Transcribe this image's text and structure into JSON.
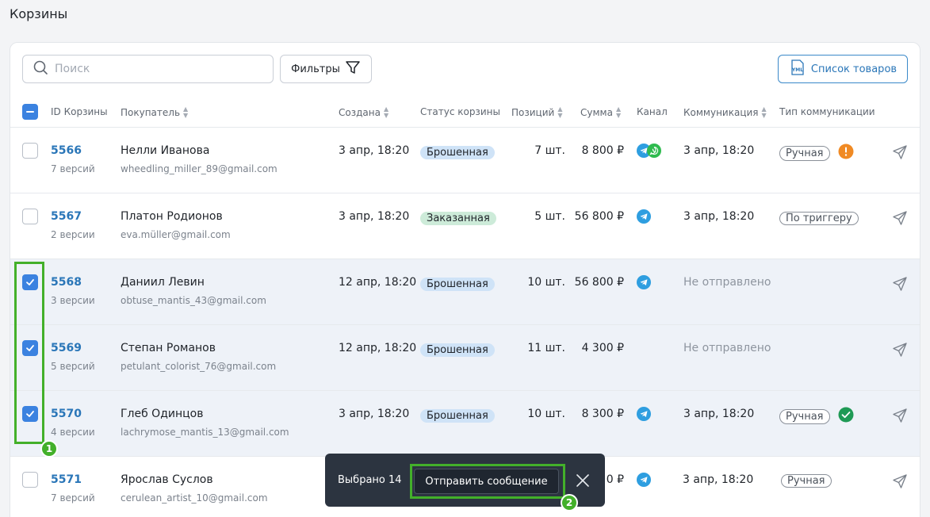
{
  "page": {
    "title": "Корзины"
  },
  "toolbar": {
    "search_placeholder": "Поиск",
    "filters_label": "Фильтры",
    "yml_label": "Список товаров",
    "yml_icon_text": "YML"
  },
  "table": {
    "headers": {
      "id": "ID Корзины",
      "buyer": "Покупатель",
      "created": "Создана",
      "status": "Статус корзины",
      "positions": "Позиций",
      "sum": "Сумма",
      "channel": "Канал",
      "communication": "Коммуникация",
      "comm_type": "Тип коммуникации"
    },
    "rows": [
      {
        "id": "5566",
        "versions": "7 версий",
        "name": "Нелли Иванова",
        "email": "wheedling_miller_89@gmail.com",
        "created": "3 апр, 18:20",
        "status": "Брошенная",
        "positions": "7 шт.",
        "sum": "8 800 ₽",
        "channels": [
          "telegram-icon",
          "whatsapp-icon"
        ],
        "communication": "3 апр, 18:20",
        "comm_type": "Ручная",
        "comm_status_icon": "warning-icon",
        "checked": false
      },
      {
        "id": "5567",
        "versions": "2 версии",
        "name": "Платон Родионов",
        "email": "eva.müller@gmail.com",
        "created": "3 апр, 18:20",
        "status": "Заказанная",
        "positions": "5 шт.",
        "sum": "56 800 ₽",
        "channels": [
          "telegram-icon"
        ],
        "communication": "3 апр, 18:20",
        "comm_type": "По триггеру",
        "comm_status_icon": "",
        "checked": false
      },
      {
        "id": "5568",
        "versions": "3 версии",
        "name": "Даниил Левин",
        "email": "obtuse_mantis_43@gmail.com",
        "created": "12 апр, 18:20",
        "status": "Брошенная",
        "positions": "10 шт.",
        "sum": "56 800 ₽",
        "channels": [
          "telegram-icon"
        ],
        "communication": "Не отправлено",
        "comm_type": "",
        "comm_status_icon": "",
        "checked": true
      },
      {
        "id": "5569",
        "versions": "5 версий",
        "name": "Степан Романов",
        "email": "petulant_colorist_76@gmail.com",
        "created": "12 апр, 18:20",
        "status": "Брошенная",
        "positions": "11 шт.",
        "sum": "4 300 ₽",
        "channels": [],
        "communication": "Не отправлено",
        "comm_type": "",
        "comm_status_icon": "",
        "checked": true
      },
      {
        "id": "5570",
        "versions": "4 версии",
        "name": "Глеб Одинцов",
        "email": "lachrymose_mantis_13@gmail.com",
        "created": "3 апр, 18:20",
        "status": "Брошенная",
        "positions": "10 шт.",
        "sum": "8 300 ₽",
        "channels": [
          "telegram-icon"
        ],
        "communication": "3 апр, 18:20",
        "comm_type": "Ручная",
        "comm_status_icon": "check-circle-icon",
        "checked": true
      },
      {
        "id": "5571",
        "versions": "7 версий",
        "name": "Ярослав Суслов",
        "email": "cerulean_artist_10@gmail.com",
        "created": "",
        "status": "",
        "positions": "",
        "sum": "0 ₽",
        "channels": [
          "telegram-icon"
        ],
        "communication": "3 апр, 18:20",
        "comm_type": "Ручная",
        "comm_status_icon": "",
        "checked": false
      }
    ]
  },
  "selection_bar": {
    "selected_text": "Выбрано 14",
    "send_label": "Отправить сообщение"
  },
  "annotations": {
    "one": "1",
    "two": "2"
  },
  "colors": {
    "accent": "#3b82e0",
    "highlight": "#43b02a",
    "link": "#2a76b8"
  }
}
